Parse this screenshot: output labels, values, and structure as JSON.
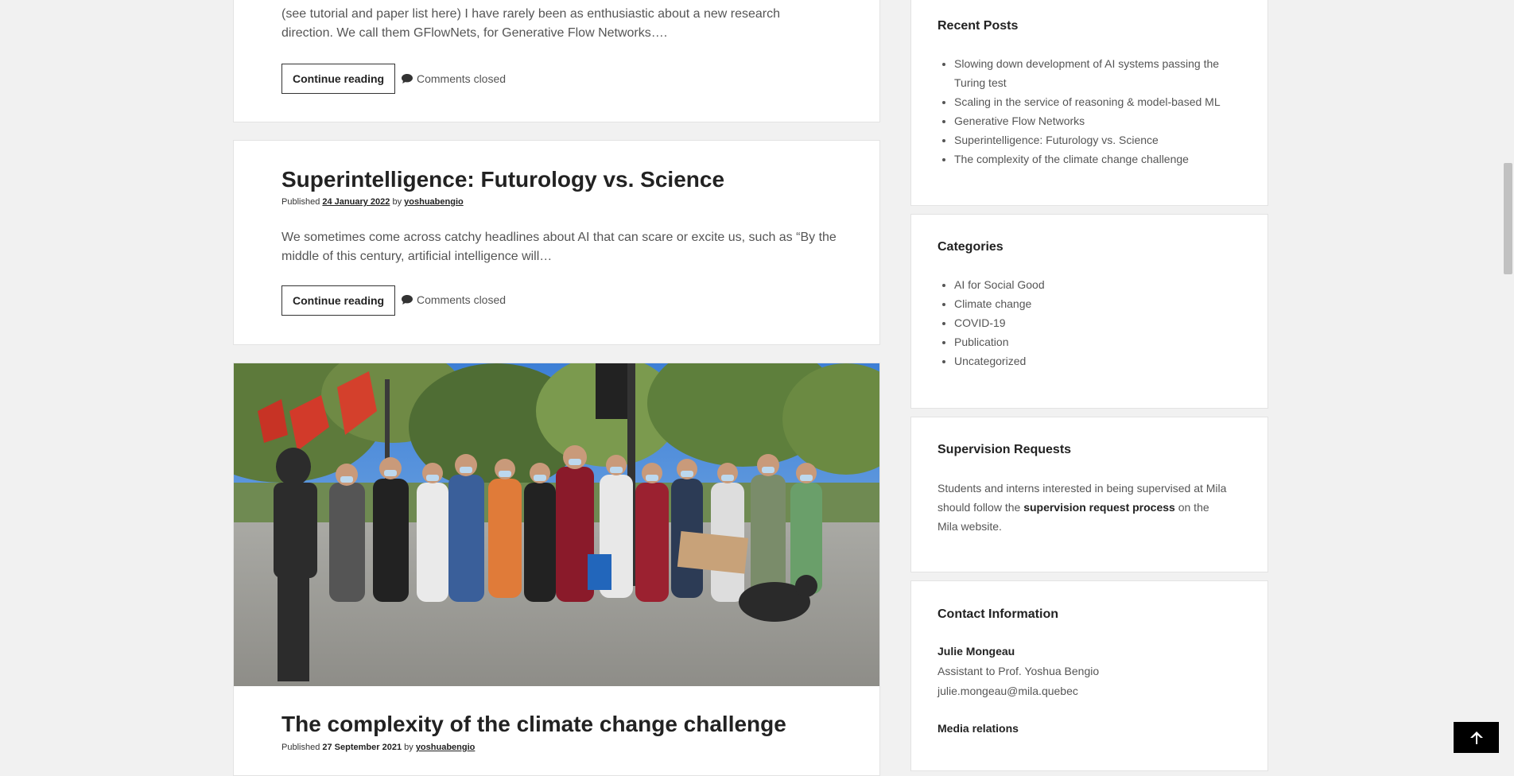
{
  "post_gflownets": {
    "excerpt": "(see tutorial and paper list here) I have rarely been as enthusiastic about a new research direction. We call them GFlowNets, for Generative Flow Networks….",
    "continue_label": "Continue reading",
    "comments_label": "Comments closed"
  },
  "post_superintelligence": {
    "title": "Superintelligence: Futurology vs. Science",
    "published_label": "Published",
    "date": "24 January 2022",
    "by_label": "by",
    "author": "yoshuabengio",
    "excerpt": "We sometimes come across catchy headlines about AI that can scare or excite us, such as “By the middle of this century, artificial intelligence will…",
    "continue_label": "Continue reading",
    "comments_label": "Comments closed"
  },
  "post_climate": {
    "title": "The complexity of the climate change challenge",
    "published_label": "Published",
    "date": "27 September 2021",
    "by_label": "by",
    "author": "yoshuabengio"
  },
  "sidebar": {
    "recent_posts": {
      "title": "Recent Posts",
      "items": [
        "Slowing down development of AI systems passing the Turing test",
        "Scaling in the service of reasoning & model-based ML",
        "Generative Flow Networks",
        "Superintelligence: Futurology vs. Science",
        "The complexity of the climate change challenge"
      ]
    },
    "categories": {
      "title": "Categories",
      "items": [
        "AI for Social Good",
        "Climate change",
        "COVID-19",
        "Publication",
        "Uncategorized"
      ]
    },
    "supervision": {
      "title": "Supervision Requests",
      "text_before": "Students and interns interested in being supervised at Mila should follow the ",
      "link": "supervision request process",
      "text_after": " on the Mila website."
    },
    "contact": {
      "title": "Contact Information",
      "name": "Julie Mongeau",
      "role": "Assistant to Prof. Yoshua Bengio",
      "email": "julie.mongeau@mila.quebec",
      "media_title": "Media relations"
    }
  },
  "icons": {
    "comment": "comment-bubble-icon",
    "back_to_top": "arrow-up-icon"
  }
}
